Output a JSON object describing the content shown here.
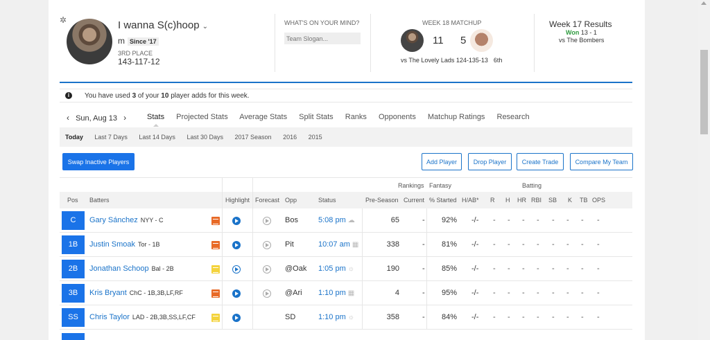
{
  "header": {
    "team_name": "I wanna S(c)hoop",
    "owner": "m",
    "since": "Since '17",
    "place": "3RD PLACE",
    "record": "143-117-12",
    "mind_label": "WHAT'S ON YOUR MIND?",
    "slogan_placeholder": "Team Slogan...",
    "matchup_label": "WEEK 18 MATCHUP",
    "my_score": "11",
    "opp_score": "5",
    "opponent_line": "vs The Lovely Lads 124-135-13",
    "opponent_rank": "6th",
    "results_title": "Week 17 Results",
    "results_won": "Won",
    "results_score": "13 - 1",
    "results_vs": "vs The Bombers"
  },
  "info": {
    "icon": "info-icon",
    "text": "You have used 3 of your 10 player adds for this week."
  },
  "nav": {
    "prev": "‹",
    "date": "Sun, Aug 13",
    "next": "›",
    "tabs": [
      "Stats",
      "Projected Stats",
      "Average Stats",
      "Split Stats",
      "Ranks",
      "Opponents",
      "Matchup Ratings",
      "Research"
    ],
    "subtabs": [
      "Today",
      "Last 7 Days",
      "Last 14 Days",
      "Last 30 Days",
      "2017 Season",
      "2016",
      "2015"
    ]
  },
  "buttons": {
    "swap": "Swap Inactive Players",
    "add": "Add Player",
    "drop": "Drop Player",
    "trade": "Create Trade",
    "compare": "Compare My Team"
  },
  "table": {
    "group_headers": {
      "rankings": "Rankings",
      "fantasy": "Fantasy",
      "batting": "Batting"
    },
    "columns": [
      "Pos",
      "Batters",
      "Highlight",
      "Forecast",
      "Opp",
      "Status",
      "Pre-Season",
      "Current",
      "% Started",
      "H/AB*",
      "R",
      "H",
      "HR",
      "RBI",
      "SB",
      "K",
      "TB",
      "OPS"
    ],
    "rows": [
      {
        "pos": "C",
        "name": "Gary Sánchez",
        "team": "NYY - C",
        "note": "orange",
        "play": "filled",
        "forecast": true,
        "opp": "Bos",
        "status": "5:08 pm",
        "weather": "☁",
        "preseason": "65",
        "current": "-",
        "started": "92%",
        "hab": "-/-"
      },
      {
        "pos": "1B",
        "name": "Justin Smoak",
        "team": "Tor - 1B",
        "note": "orange",
        "play": "filled",
        "forecast": true,
        "opp": "Pit",
        "status": "10:07 am",
        "weather": "▦",
        "preseason": "338",
        "current": "-",
        "started": "81%",
        "hab": "-/-"
      },
      {
        "pos": "2B",
        "name": "Jonathan Schoop",
        "team": "Bal - 2B",
        "note": "yellow",
        "play": "outline",
        "forecast": true,
        "opp": "@Oak",
        "status": "1:05 pm",
        "weather": "☼",
        "preseason": "190",
        "current": "-",
        "started": "85%",
        "hab": "-/-"
      },
      {
        "pos": "3B",
        "name": "Kris Bryant",
        "team": "ChC - 1B,3B,LF,RF",
        "note": "orange",
        "play": "filled",
        "forecast": true,
        "opp": "@Ari",
        "status": "1:10 pm",
        "weather": "▦",
        "preseason": "4",
        "current": "-",
        "started": "95%",
        "hab": "-/-"
      },
      {
        "pos": "SS",
        "name": "Chris Taylor",
        "team": "LAD - 2B,3B,SS,LF,CF",
        "note": "yellow",
        "play": "filled",
        "forecast": false,
        "opp": "SD",
        "status": "1:10 pm",
        "weather": "☼",
        "preseason": "358",
        "current": "-",
        "started": "84%",
        "hab": "-/-"
      }
    ],
    "stat_placeholder": "-"
  },
  "colors": {
    "accent": "#1a73e8",
    "link": "#1a73c9",
    "win": "#2e9b3e",
    "note_orange": "#e86a27",
    "note_yellow": "#f4d33c"
  }
}
